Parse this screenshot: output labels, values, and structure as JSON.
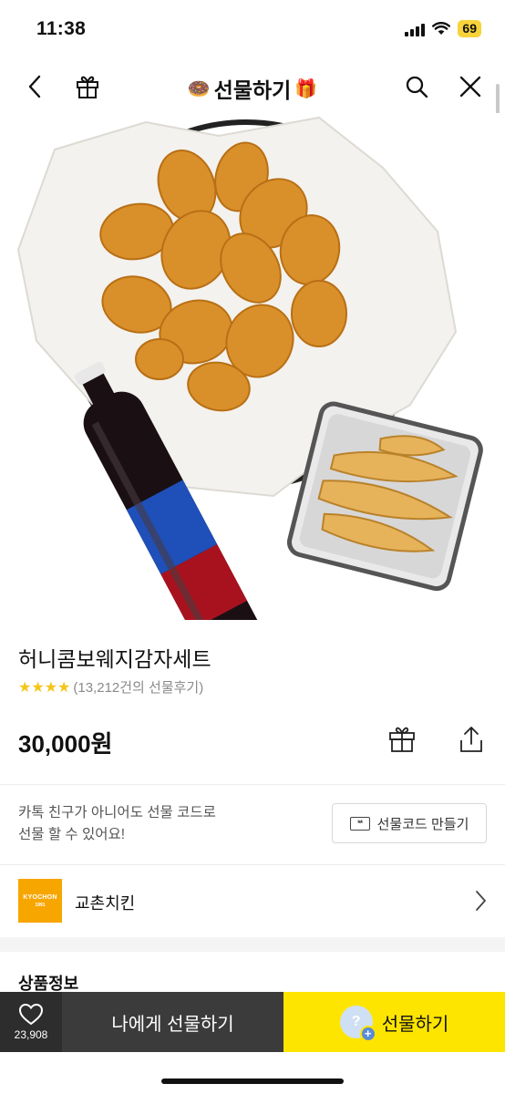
{
  "status_bar": {
    "time": "11:38",
    "battery": "69",
    "battery_color": "#f7d33a"
  },
  "nav": {
    "title": "선물하기",
    "left_deco": "🍩",
    "right_deco": "🎁",
    "icons": [
      "back-icon",
      "gift-box-icon",
      "search-icon",
      "close-icon"
    ]
  },
  "product": {
    "name": "허니콤보웨지감자세트",
    "stars": "★★★★",
    "review_text": "(13,212건의 선물후기)",
    "price": "30,000원"
  },
  "gift_code": {
    "description_line1": "카톡 친구가 아니어도 선물 코드로",
    "description_line2": "선물 할 수 있어요!",
    "button_label": "선물코드 만들기",
    "ticket_glyph": "**"
  },
  "brand": {
    "name": "교촌치킨",
    "logo_line1": "KYOCHON",
    "logo_line2": "1991",
    "logo_color": "#f7a600"
  },
  "section": {
    "title": "상품정보"
  },
  "bottom_bar": {
    "like_count": "23,908",
    "self_gift_label": "나에게 선물하기",
    "gift_label": "선물하기",
    "gift_bubble_glyph": "?",
    "gift_plus_glyph": "+",
    "accent": "#fee500"
  }
}
